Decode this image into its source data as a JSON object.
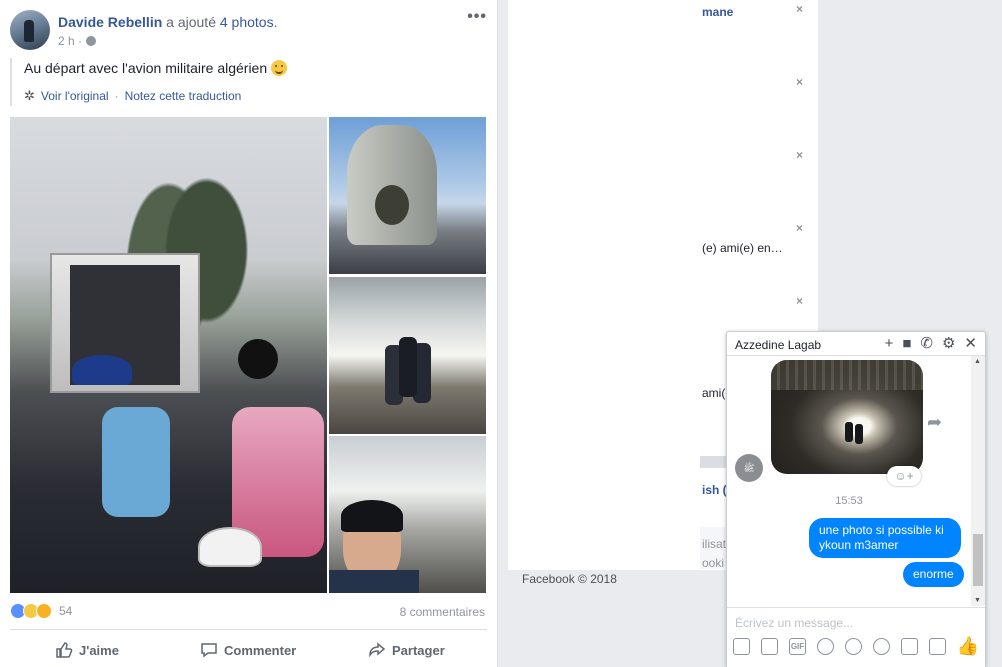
{
  "post": {
    "author": "Davide Rebellin",
    "action_text": " a ajouté ",
    "photos_link": "4 photos",
    "period": ".",
    "time": "2 h ·",
    "more": "•••",
    "text": "Au départ avec l'avion militaire algérien ",
    "see_original": "Voir l'original",
    "separator": " · ",
    "rate_translation": "Notez cette traduction",
    "reaction_count": "54",
    "comments": "8 commentaires",
    "actions": {
      "like": "J'aime",
      "comment": "Commenter",
      "share": "Partager"
    }
  },
  "sidebar": {
    "fragments": {
      "f1": "mane",
      "f2": "(e) ami(e) en…",
      "f3": "ami(e",
      "f4": "ish (",
      "f5": "ilisat",
      "f6": "ooki"
    },
    "close_glyph": "×",
    "footer": "Facebook © 2018"
  },
  "chat": {
    "contact_name": "Azzedine Lagab",
    "time": "15:53",
    "message1": "une photo si possible ki ykoun m3amer",
    "message2": "enorme",
    "input_placeholder": "Écrivez un message...",
    "gif_label": "GIF",
    "sender_avatar_text": "ﷺ"
  },
  "colors": {
    "brand_blue": "#365899",
    "messenger_blue": "#0084ff",
    "muted": "#90949c"
  }
}
